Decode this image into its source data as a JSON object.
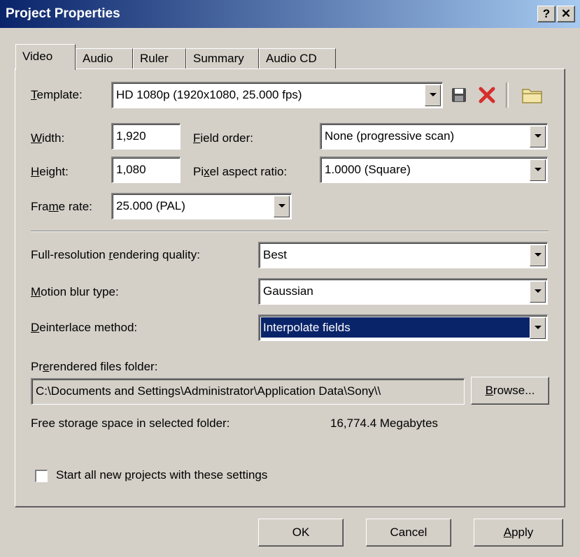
{
  "window": {
    "title": "Project Properties",
    "help_label": "?",
    "close_label": "✕"
  },
  "tabs": [
    {
      "label": "Video",
      "active": true
    },
    {
      "label": "Audio"
    },
    {
      "label": "Ruler"
    },
    {
      "label": "Summary"
    },
    {
      "label": "Audio CD"
    }
  ],
  "video": {
    "template_label_pre": "",
    "template_label_key": "T",
    "template_label_post": "emplate:",
    "template_value": "HD 1080p (1920x1080, 25.000 fps)",
    "width_label_key": "W",
    "width_label_post": "idth:",
    "width_value": "1,920",
    "height_label_key": "H",
    "height_label_post": "eight:",
    "height_value": "1,080",
    "field_order_label_key": "F",
    "field_order_label_post": "ield order:",
    "field_order_value": "None (progressive scan)",
    "pixel_aspect_label_pre": "Pi",
    "pixel_aspect_label_key": "x",
    "pixel_aspect_label_post": "el aspect ratio:",
    "pixel_aspect_value": "1.0000 (Square)",
    "frame_rate_label_pre": "Fra",
    "frame_rate_label_key": "m",
    "frame_rate_label_post": "e rate:",
    "frame_rate_value": "25.000 (PAL)",
    "rendering_label_pre": "Full-resolution ",
    "rendering_label_key": "r",
    "rendering_label_post": "endering quality:",
    "rendering_value": "Best",
    "motion_blur_label_key": "M",
    "motion_blur_label_post": "otion blur type:",
    "motion_blur_value": "Gaussian",
    "deinterlace_label_key": "D",
    "deinterlace_label_post": "einterlace method:",
    "deinterlace_value": "Interpolate fields",
    "prerender_label_pre": "Pr",
    "prerender_label_key": "e",
    "prerender_label_post": "rendered files folder:",
    "prerender_path": "C:\\Documents and Settings\\Administrator\\Application Data\\Sony\\\\",
    "browse_key": "B",
    "browse_post": "rowse...",
    "free_space_label": "Free storage space in selected folder:",
    "free_space_value": "16,774.4 Megabytes",
    "start_all_pre": "Start all new ",
    "start_all_key": "p",
    "start_all_post": "rojects with these settings",
    "start_all_checked": false
  },
  "buttons": {
    "ok": "OK",
    "cancel": "Cancel",
    "apply_key": "A",
    "apply_post": "pply"
  },
  "icons": {
    "save": "save-icon",
    "delete": "delete-icon",
    "folder": "folder-icon"
  },
  "colors": {
    "titlebar_start": "#0a246a",
    "titlebar_end": "#a6caf0",
    "face": "#d4d0c8",
    "selection": "#0a246a",
    "delete_red": "#d62e2e"
  }
}
